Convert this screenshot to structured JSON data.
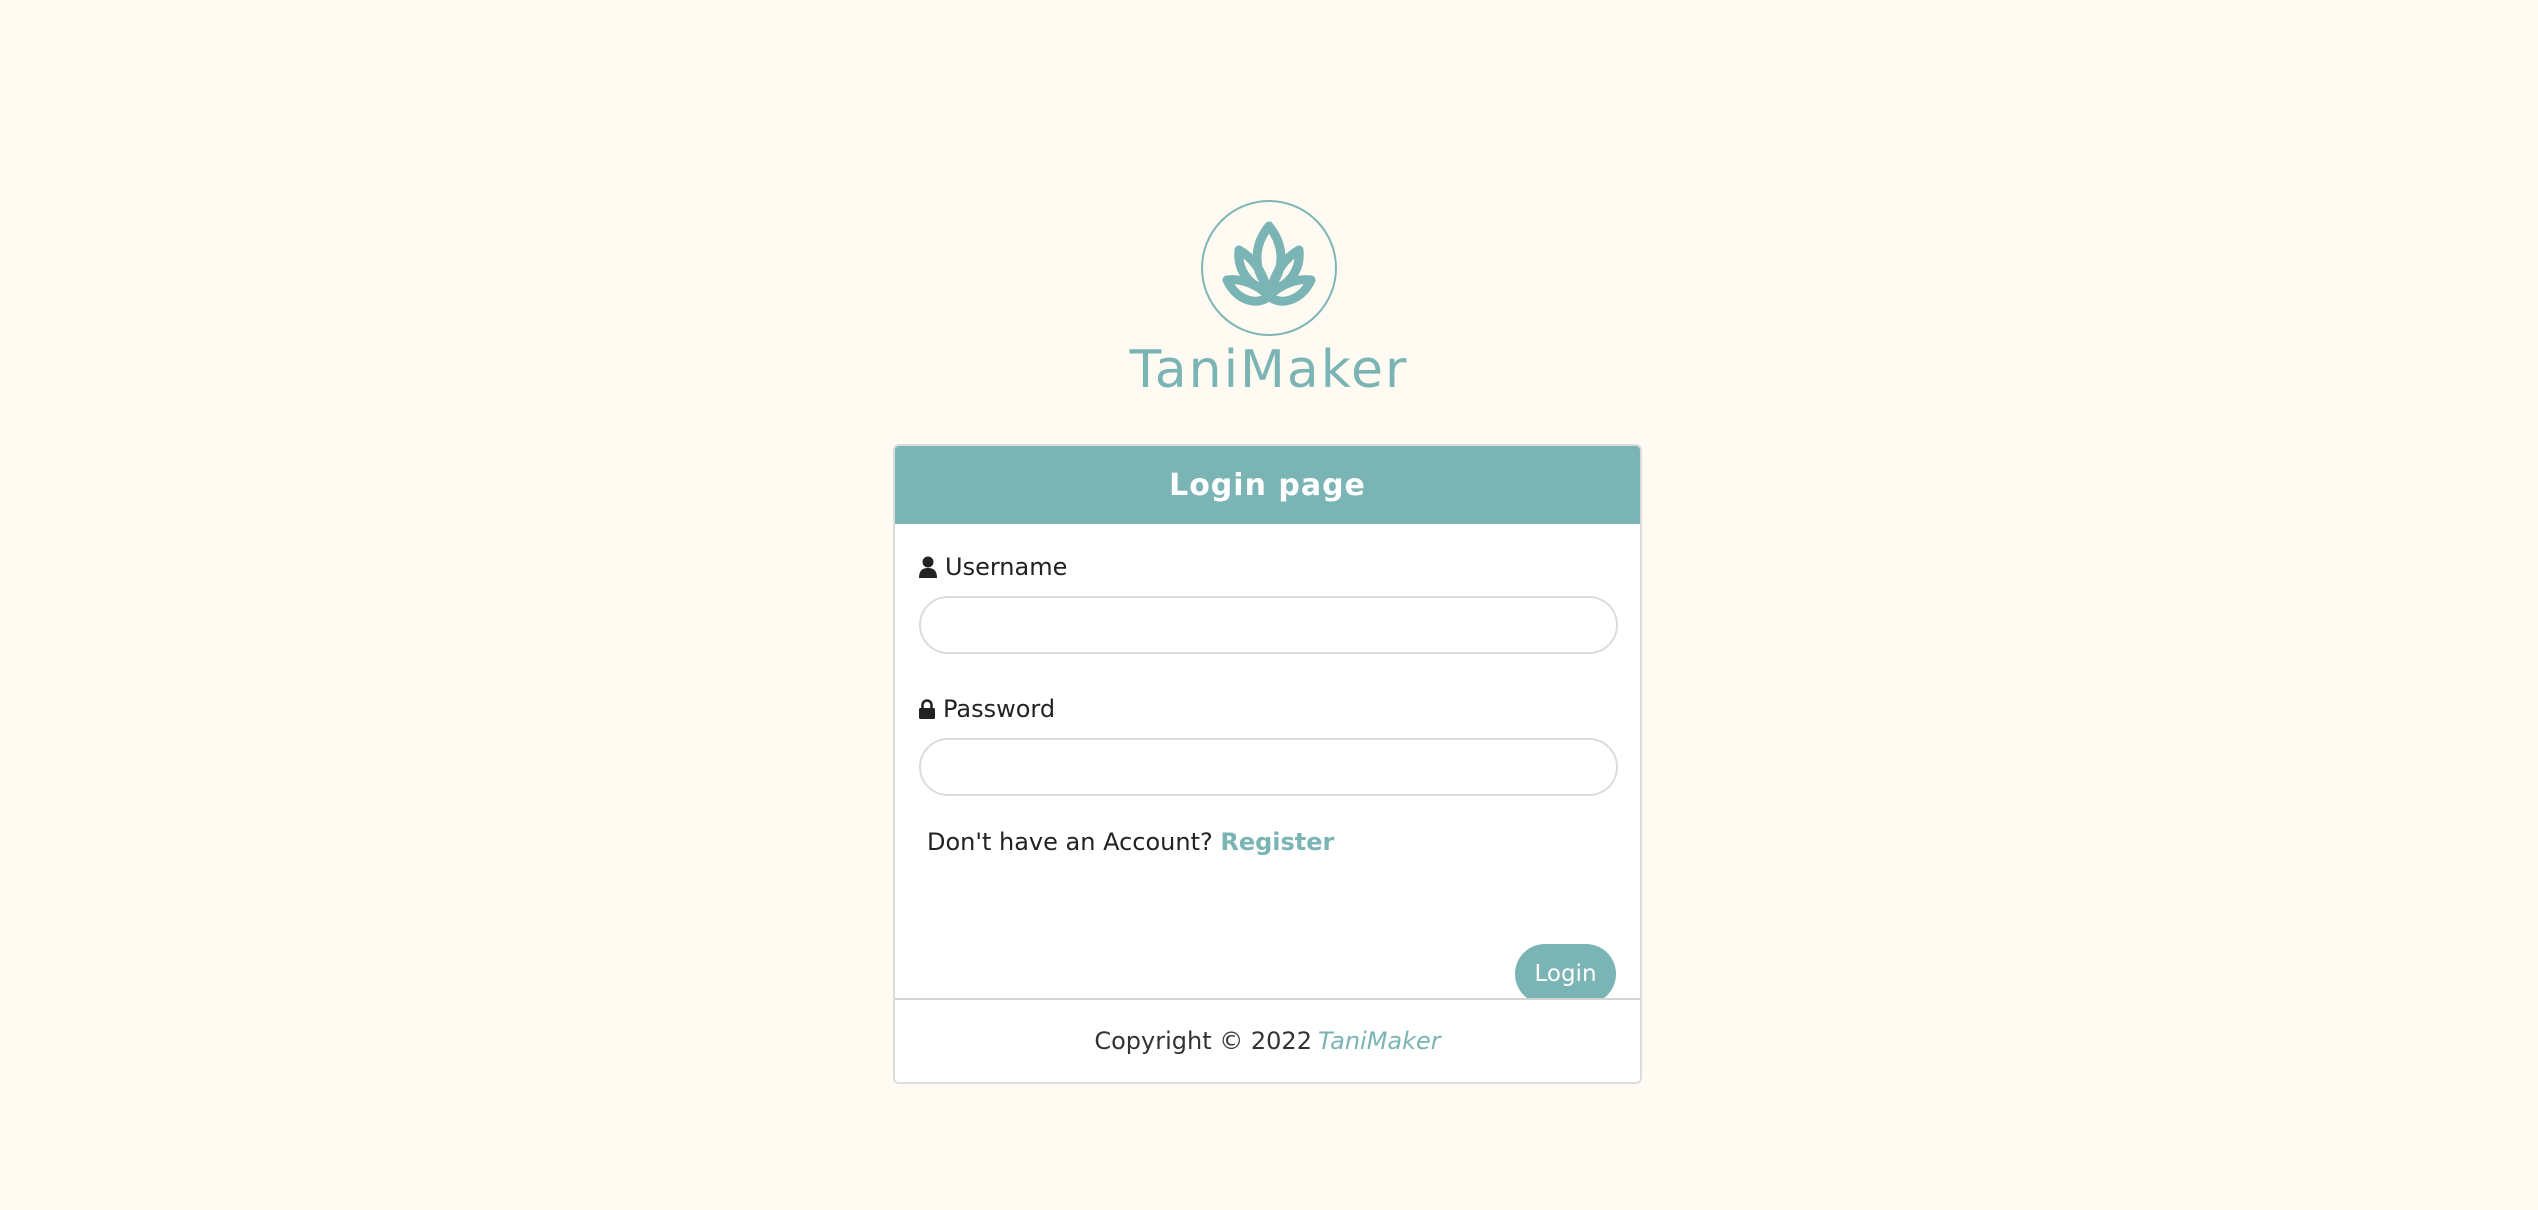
{
  "brand": {
    "name": "TaniMaker",
    "logo_icon": "lotus-icon",
    "accent_color": "#7ab4b5",
    "background_color": "#fffbf2"
  },
  "login_card": {
    "header_title": "Login page",
    "username": {
      "icon": "user-icon",
      "label": "Username",
      "value": "",
      "placeholder": ""
    },
    "password": {
      "icon": "lock-icon",
      "label": "Password",
      "value": "",
      "placeholder": ""
    },
    "register_prompt": "Don't have an Account?",
    "register_link": "Register",
    "login_button": "Login"
  },
  "footer": {
    "copyright": "Copyright © 2022",
    "brand": "TaniMaker"
  }
}
